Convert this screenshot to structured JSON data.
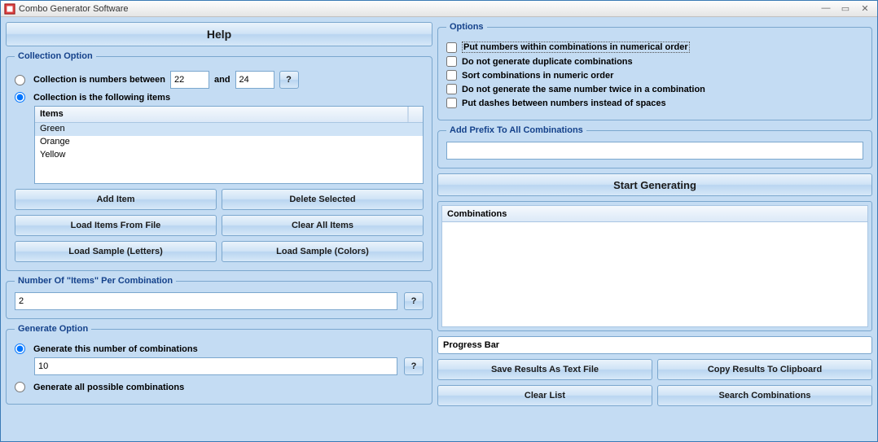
{
  "window": {
    "title": "Combo Generator Software"
  },
  "help_button": "Help",
  "collection": {
    "legend": "Collection Option",
    "radio_numbers_label": "Collection is numbers between",
    "num_from": "22",
    "and_label": "and",
    "num_to": "24",
    "qmark": "?",
    "radio_items_label": "Collection is the following items",
    "items_header": "Items",
    "items": [
      "Green",
      "Orange",
      "Yellow"
    ],
    "btn_add": "Add Item",
    "btn_delete": "Delete Selected",
    "btn_load_file": "Load Items From File",
    "btn_clear": "Clear All Items",
    "btn_sample_letters": "Load Sample (Letters)",
    "btn_sample_colors": "Load Sample (Colors)"
  },
  "per_combo": {
    "legend": "Number Of \"Items\" Per Combination",
    "value": "2",
    "qmark": "?"
  },
  "generate": {
    "legend": "Generate Option",
    "radio_count_label": "Generate this number of combinations",
    "count_value": "10",
    "qmark": "?",
    "radio_all_label": "Generate all possible combinations"
  },
  "options": {
    "legend": "Options",
    "o1": "Put numbers within combinations in numerical order",
    "o2": "Do not generate duplicate combinations",
    "o3": "Sort combinations in numeric order",
    "o4": "Do not generate the same number twice in a combination",
    "o5": "Put dashes between numbers instead of spaces"
  },
  "prefix": {
    "legend": "Add Prefix To All Combinations",
    "value": ""
  },
  "start_button": "Start Generating",
  "combinations_header": "Combinations",
  "progress_label": "Progress Bar",
  "result": {
    "save": "Save Results As Text File",
    "copy": "Copy Results To Clipboard",
    "clear": "Clear List",
    "search": "Search Combinations"
  }
}
